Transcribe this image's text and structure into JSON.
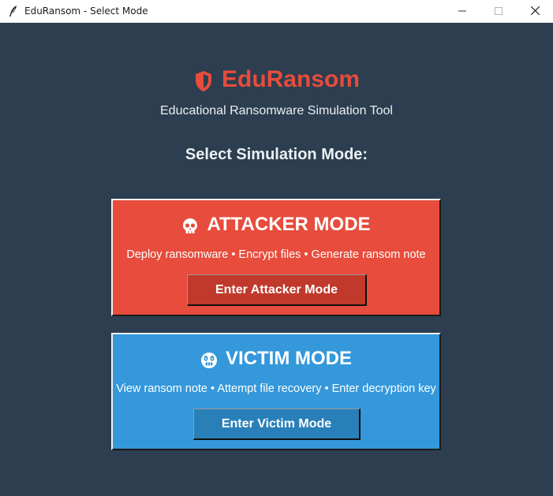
{
  "window": {
    "title": "EduRansom - Select Mode",
    "controls": [
      "minimize",
      "maximize",
      "close"
    ]
  },
  "header": {
    "icon": "shield-icon",
    "title": "EduRansom",
    "subtitle": "Educational Ransomware Simulation Tool"
  },
  "prompt": "Select Simulation Mode:",
  "modes": [
    {
      "icon": "skull-icon",
      "title": "ATTACKER MODE",
      "description": "Deploy ransomware • Encrypt files • Generate ransom note",
      "button_label": "Enter Attacker Mode"
    },
    {
      "icon": "distressed-face-icon",
      "title": "VICTIM MODE",
      "description": "View ransom note • Attempt file recovery • Enter decryption key",
      "button_label": "Enter Victim Mode"
    }
  ],
  "colors": {
    "background": "#2c3e50",
    "accent": "#e74c3c",
    "attacker_card": "#e74c3c",
    "attacker_button": "#c0392b",
    "victim_card": "#3498db",
    "victim_button": "#2980b9",
    "text_light": "#ecf0f1"
  }
}
